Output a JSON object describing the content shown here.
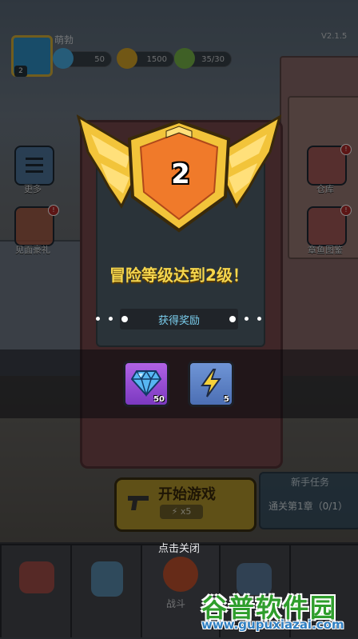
{
  "hud": {
    "player_name": "萌勃",
    "avatar_level": "2",
    "version": "V2.1.5",
    "resources": [
      {
        "icon": "blue-gem-icon",
        "value": "50"
      },
      {
        "icon": "gold-coin-icon",
        "value": "1500"
      },
      {
        "icon": "lightning-energy-icon",
        "value": "35/30"
      }
    ]
  },
  "side_menu": {
    "more_label": "更多",
    "news_label": "见面豪礼",
    "warehouse_label": "仓库",
    "illustrated_label": "章鱼图鉴"
  },
  "lobby": {
    "start_button_label": "开始游戏",
    "start_cost": "x5",
    "task_title": "新手任务",
    "task_desc": "通关第1章（0/1）",
    "battle_tab_label": "战斗"
  },
  "level_up": {
    "level": "2",
    "message": "冒险等级达到2级！",
    "rewards_title": "获得奖励",
    "rewards": [
      {
        "name": "gem",
        "icon": "blue-gem-icon",
        "count": "50"
      },
      {
        "name": "energy",
        "icon": "lightning-icon",
        "count": "5"
      }
    ],
    "close_hint": "点击关闭"
  },
  "watermark": {
    "title": "谷普软件园",
    "url": "www.gupuxiazai.com"
  },
  "colors": {
    "gold": "#f5d64d",
    "reward_title": "#7bcfef",
    "gem_tile": "#9b4fd6",
    "energy_tile": "#5b82c6",
    "watermark_green": "#2f9e2c"
  }
}
